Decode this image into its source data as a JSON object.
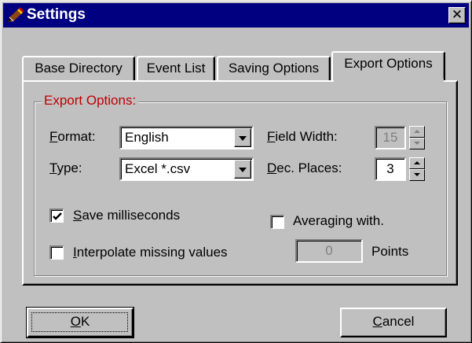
{
  "window": {
    "title": "Settings",
    "close_label": "✕",
    "icon": "pen-icon"
  },
  "tabs": [
    {
      "label": "Base Directory",
      "active": false
    },
    {
      "label": "Event List",
      "active": false
    },
    {
      "label": "Saving Options",
      "active": false
    },
    {
      "label": "Export Options",
      "active": true
    }
  ],
  "group": {
    "title": "Export Options:",
    "title_color": "#c00000"
  },
  "format": {
    "label_accel": "F",
    "label_rest": "ormat:",
    "value": "English"
  },
  "type": {
    "label_accel": "T",
    "label_rest": "ype:",
    "value": "Excel  *.csv"
  },
  "field_width": {
    "label_accel": "F",
    "label_rest": "ield Width:",
    "value": "15",
    "enabled": false
  },
  "dec_places": {
    "label_accel": "D",
    "label_rest": "ec. Places:",
    "value": "3",
    "enabled": true
  },
  "save_ms": {
    "label_accel": "S",
    "label_rest": "ave milliseconds",
    "checked": true
  },
  "interpolate": {
    "label_accel": "I",
    "label_rest": "nterpolate missing values",
    "checked": false
  },
  "averaging": {
    "label": "Averaging with.",
    "checked": false,
    "points_value": "0",
    "points_label": "Points"
  },
  "buttons": {
    "ok_accel": "O",
    "ok_rest": "K",
    "cancel_accel": "C",
    "cancel_rest": "ancel"
  }
}
